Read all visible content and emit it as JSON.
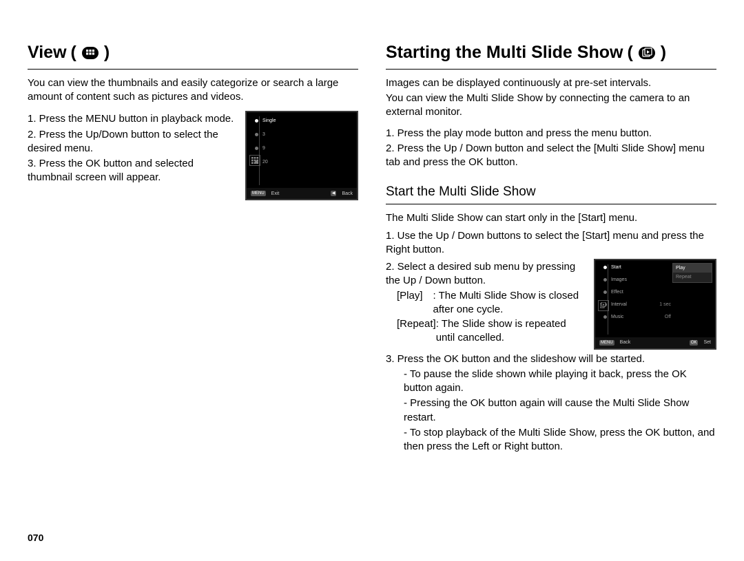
{
  "pageNumber": "070",
  "left": {
    "title": "View",
    "intro": "You can view the thumbnails and easily categorize or search a large amount of content such as pictures and videos.",
    "steps": [
      "1. Press the MENU button in playback mode.",
      "2. Press the Up/Down button to select the desired menu.",
      "3. Press the OK button and selected thumbnail screen will appear."
    ],
    "screenshot": {
      "items": [
        "Single",
        "3",
        "9",
        "20"
      ],
      "selected": "Single",
      "footerLeft": "Exit",
      "footerLeftBtn": "MENU",
      "footerRight": "Back",
      "footerRightBtn": "◀"
    }
  },
  "right": {
    "title": "Starting the Multi Slide Show",
    "intro1": "Images can be displayed continuously at pre-set intervals.",
    "intro2": "You can view the Multi Slide Show by connecting the camera to an external monitor.",
    "steps": [
      "1. Press the play mode button and press the menu button.",
      "2. Press the Up / Down button and select the [Multi Slide Show] menu tab and press the OK button."
    ],
    "sub": {
      "title": "Start the Multi Slide Show",
      "intro": "The Multi Slide Show can start only in the [Start] menu.",
      "step1": "1. Use the Up / Down buttons to select the [Start] menu and press the Right button.",
      "step2": "2. Select a desired sub menu by pressing the Up / Down button.",
      "defs": [
        {
          "label": "[Play]",
          "text": ": The Multi Slide Show is closed after one cycle."
        },
        {
          "label": "[Repeat]",
          "text": ": The Slide show is repeated until cancelled."
        }
      ],
      "step3": "3. Press the OK button and the slideshow will be started.",
      "notes": [
        "- To pause the slide shown while playing it back, press the OK button again.",
        "- Pressing the OK button again will cause the Multi Slide Show restart.",
        "- To stop playback of the Multi Slide Show, press the OK button, and then press the Left or Right button."
      ],
      "screenshot": {
        "leftItems": [
          "Start",
          "Images",
          "Effect",
          "Interval",
          "Music"
        ],
        "rightItems": [
          "Play",
          "Repeat"
        ],
        "intervalValue": "1 sec",
        "musicValue": "Off",
        "selectedLeft": "Start",
        "selectedRight": "Play",
        "footerLeftBtn": "MENU",
        "footerLeft": "Back",
        "footerRightBtn": "OK",
        "footerRight": "Set"
      }
    }
  }
}
